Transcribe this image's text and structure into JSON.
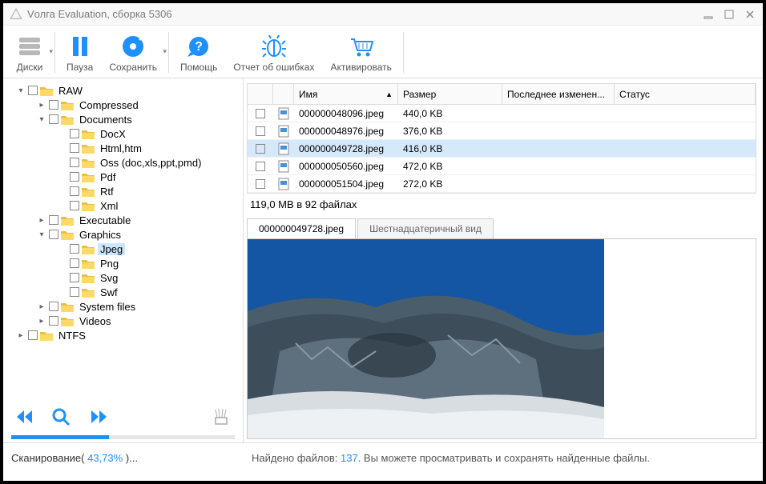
{
  "title": "Vолга Evaluation, сборка 5306",
  "toolbar": {
    "disks": "Диски",
    "pause": "Пауза",
    "save": "Сохранить",
    "help": "Помощь",
    "bugs": "Отчет об ошибках",
    "activate": "Активировать"
  },
  "tree": {
    "raw": "RAW",
    "compressed": "Compressed",
    "documents": "Documents",
    "docx": "DocX",
    "html": "Html,htm",
    "oss": "Oss (doc,xls,ppt,pmd)",
    "pdf": "Pdf",
    "rtf": "Rtf",
    "xml": "Xml",
    "executable": "Executable",
    "graphics": "Graphics",
    "jpeg": "Jpeg",
    "png": "Png",
    "svg": "Svg",
    "swf": "Swf",
    "system": "System files",
    "videos": "Videos",
    "ntfs": "NTFS"
  },
  "columns": {
    "name": "Имя",
    "size": "Размер",
    "modified": "Последнее изменен...",
    "status": "Статус"
  },
  "files": [
    {
      "name": "000000048096.jpeg",
      "size": "440,0 KB"
    },
    {
      "name": "000000048976.jpeg",
      "size": "376,0 KB"
    },
    {
      "name": "000000049728.jpeg",
      "size": "416,0 KB"
    },
    {
      "name": "000000050560.jpeg",
      "size": "472,0 KB"
    },
    {
      "name": "000000051504.jpeg",
      "size": "272,0 KB"
    }
  ],
  "summary": "119,0 MB в 92 файлах",
  "preview_tabs": {
    "file": "000000049728.jpeg",
    "hex": "Шестнадцатеричный вид"
  },
  "status": {
    "scan_label": "Сканирование( ",
    "scan_pct": "43,73%",
    "scan_suffix": " )...",
    "found_label": "Найдено файлов: ",
    "found_count": "137",
    "found_suffix": ". Вы можете просматривать и сохранять найденные файлы."
  }
}
